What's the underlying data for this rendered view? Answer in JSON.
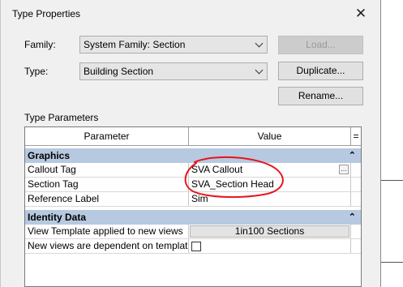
{
  "dialog": {
    "title": "Type Properties",
    "close_glyph": "✕"
  },
  "family": {
    "label": "Family:",
    "value": "System Family: Section"
  },
  "type": {
    "label": "Type:",
    "value": "Building Section"
  },
  "buttons": {
    "load": "Load...",
    "duplicate": "Duplicate...",
    "rename": "Rename..."
  },
  "type_parameters": {
    "heading": "Type Parameters",
    "columns": {
      "parameter": "Parameter",
      "value": "Value",
      "marker": "="
    },
    "groups": [
      {
        "name": "Graphics",
        "collapse_glyph": "⌃",
        "rows": [
          {
            "parameter": "Callout Tag",
            "value": "SVA Callout"
          },
          {
            "parameter": "Section Tag",
            "value": "SVA_Section Head"
          },
          {
            "parameter": "Reference Label",
            "value": "Sim"
          }
        ]
      },
      {
        "name": "Identity Data",
        "collapse_glyph": "⌃",
        "rows": [
          {
            "parameter": "View Template applied to new views",
            "value": "1in100 Sections"
          },
          {
            "parameter": "New views are dependent on templat",
            "value": ""
          }
        ]
      }
    ]
  },
  "icons": {
    "close": "close-icon",
    "chevron": "chevron-down-icon",
    "ellipsis": "ellipsis-icon"
  },
  "colors": {
    "group_header": "#b7c9e0",
    "annotation": "#e8141c",
    "dialog_bg": "#f0f0f0"
  }
}
